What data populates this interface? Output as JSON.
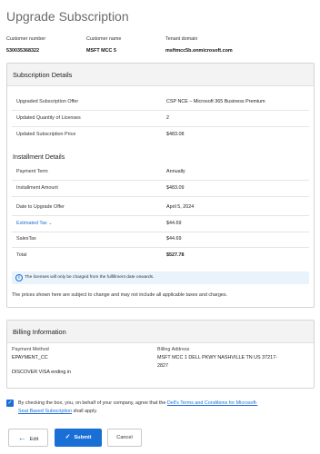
{
  "page": {
    "title": "Upgrade Subscription"
  },
  "customer": {
    "number_label": "Customer number",
    "number_value": "530035368322",
    "name_label": "Customer name",
    "name_value": "MSFT MCC 5",
    "tenant_label": "Tenant domain",
    "tenant_value": "msftmcc5b.onmicrosoft.com"
  },
  "subscription": {
    "heading": "Subscription Details",
    "offer_label": "Upgraded Subscription Offer",
    "offer_value": "CSP NCE – Microsoft 365 Business Premium",
    "qty_label": "Updated Quantity of Licenses",
    "qty_value": "2",
    "price_label": "Updated Subscription Price",
    "price_value": "$483.08"
  },
  "installment": {
    "heading": "Installment Details",
    "term_label": "Payment Term",
    "term_value": "Annually",
    "amount_label": "Installment Amount",
    "amount_value": "$483.09",
    "date_label": "Date to Upgrade Offer",
    "date_value": "April 5, 2024",
    "tax_label": "Estimated Tax",
    "tax_value": "$44.69",
    "salestax_label": "SalesTax",
    "salestax_value": "$44.69",
    "total_label": "Total",
    "total_value": "$527.78",
    "info_text": "The licenses will only be charged from the fulfillment date onwards.",
    "disclaimer": "The prices shown here are subject to change and may not include all applicable taxes and charges."
  },
  "billing": {
    "heading": "Billing Information",
    "method_label": "Payment Method",
    "method_value": "EPAYMENT_CC",
    "card_value": "DISCOVER VISA ending in",
    "address_label": "Billing Address",
    "address_line1": "MSFT MCC 1 DELL PKWY NASHVILLE TN US 37217-",
    "address_line2": "2827"
  },
  "agreement": {
    "text_before": "By checking the box, you, on behalf of your company, agree that the ",
    "link_line1": "Dell's Terms and Conditions for Microsoft-",
    "link_line2": "Seat Based Subscription",
    "text_after": " shall apply.",
    "checked": true
  },
  "actions": {
    "edit_label": "Edit",
    "submit_label": "Submit",
    "cancel_label": "Cancel"
  },
  "colors": {
    "accent": "#1a6fd6",
    "info_bg": "#e8f3fc",
    "header_bg": "#f3f3f3"
  }
}
